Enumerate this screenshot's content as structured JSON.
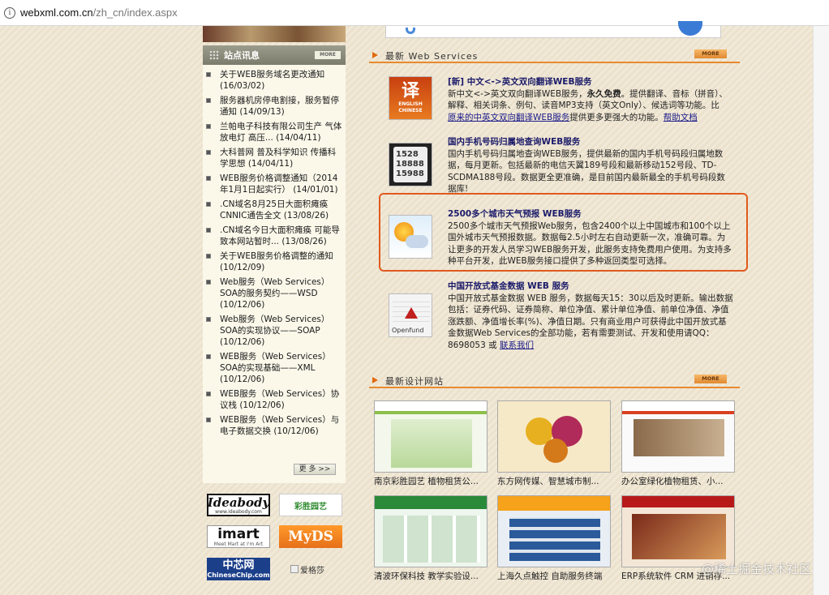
{
  "browser": {
    "url_host": "webxml.com.cn",
    "url_path": "/zh_cn/index.aspx"
  },
  "news": {
    "title": "站点讯息",
    "more": "MORE",
    "more_button": "更 多 >>",
    "items": [
      {
        "text": "关于WEB服务域名更改通知 (16/03/02)"
      },
      {
        "text": "服务器机房停电割接，服务暂停通知 (14/09/13)"
      },
      {
        "text": "兰帕电子科技有限公司生产 气体放电灯 高压... (14/04/11)"
      },
      {
        "text": "大科普网 普及科学知识 传播科学思想 (14/04/11)"
      },
      {
        "text": "WEB服务价格调整通知（2014年1月1日起实行） (14/01/01)"
      },
      {
        "text": ".CN域名8月25日大面积瘫痪 CNNIC通告全文 (13/08/26)"
      },
      {
        "text": ".CN域名今日大面积瘫痪 可能导致本网站暂时... (13/08/26)"
      },
      {
        "text": "关于WEB服务价格调整的通知 (10/12/09)"
      },
      {
        "text": "Web服务（Web Services）SOA的服务契约——WSD (10/12/06)"
      },
      {
        "text": "Web服务（Web Services）SOA的实现协议——SOAP (10/12/06)"
      },
      {
        "text": "WEB服务（Web Services）SOA的实现基础——XML (10/12/06)"
      },
      {
        "text": "WEB服务（Web Services）协议栈 (10/12/06)"
      },
      {
        "text": "WEB服务（Web Services）与电子数据交换 (10/12/06)"
      }
    ]
  },
  "partners": {
    "ideabody": "Ideabody",
    "ideabody_sub": "www.ideabody.com",
    "caisheng": "彩胜园艺",
    "imart": "imart",
    "imart_sub": "Meet Mart at I'm Art",
    "myds": "MyDS",
    "chinesechip_cn": "中芯网",
    "chinesechip_en": "ChineseChip.com",
    "aigesha": "爱格莎"
  },
  "services_section": {
    "title": "最新 Web Services",
    "more": "MORE"
  },
  "services": [
    {
      "name": "[新] 中文<->英文双向翻译WEB服务",
      "desc1": "新中文<->英文双向翻译WEB服务，",
      "desc_bold": "永久免费",
      "desc2": "。提供翻译、音标（拼音）、解释、相关词条、例句、读音MP3支持（英文Only）、候选词等功能。比",
      "link1": "原来的中英文双向翻译WEB服务",
      "desc3": "提供更多更强大的功能。",
      "link2": "帮助文档",
      "thumb_big": "译",
      "thumb_small1": "ENGLISH",
      "thumb_small2": "CHINESE"
    },
    {
      "name": "国内手机号码归属地查询WEB服务",
      "desc": "国内手机号码归属地查询WEB服务，提供最新的国内手机号码段归属地数据，每月更新。包括最新的电信天翼189号段和最新移动152号段、TD-SCDMA188号段。数据更全更准确，是目前国内最新最全的手机号码段数据库!",
      "thumb_lines": [
        "1528",
        "18888",
        "15988"
      ]
    },
    {
      "name": "2500多个城市天气预报 WEB服务",
      "desc": "2500多个城市天气预报Web服务，包含2400个以上中国城市和100个以上国外城市天气预报数据。数据每2.5小时左右自动更新一次，准确可靠。为让更多的开发人员学习WEB服务开发，此服务支持免费用户使用。为支持多种平台开发，此WEB服务接口提供了多种返回类型可选择。"
    },
    {
      "name": "中国开放式基金数据 WEB 服务",
      "desc": "中国开放式基金数据 WEB 服务，数据每天15：30以后及时更新。输出数据包括：证券代码、证券简称、单位净值、累计单位净值、前单位净值、净值涨跌额、净值增长率(%)、净值日期。只有商业用户可获得此中国开放式基金数据Web Services的全部功能，若有需要测试、开发和使用请QQ：8698053 或",
      "link": "联系我们",
      "thumb_label": "Openfund"
    }
  ],
  "sites_section": {
    "title": "最新设计网站",
    "more": "MORE"
  },
  "sites": [
    {
      "caption": "南京彩胜园艺 植物租赁公..."
    },
    {
      "caption": "东方网传媒、智慧城市制..."
    },
    {
      "caption": "办公室绿化植物租赁、小..."
    },
    {
      "caption": "清波环保科技 教学实验设..."
    },
    {
      "caption": "上海久点触控 自助服务终端"
    },
    {
      "caption": "ERP系统软件 CRM 进销存..."
    }
  ],
  "watermark": "@稀土掘金技术社区"
}
